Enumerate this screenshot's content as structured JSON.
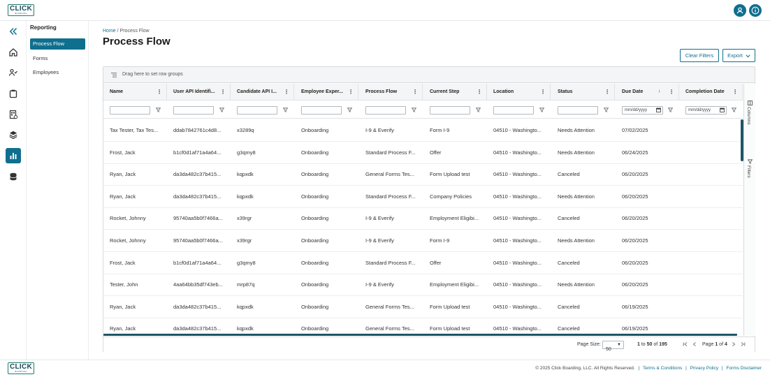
{
  "brand": {
    "logo_text": "CLICK",
    "logo_sub": "BOARDING"
  },
  "colors": {
    "accent": "#0f6f8e",
    "scrollbar": "#1e5565",
    "logo_border": "#1e7d6b"
  },
  "topbar": {
    "icons": [
      "user-circle-icon",
      "info-icon"
    ]
  },
  "rail": {
    "icons": [
      "collapse-icon",
      "home-icon",
      "people-icon",
      "clipboard-icon",
      "document-grid-icon",
      "layers-icon",
      "bar-chart-icon",
      "database-icon"
    ],
    "active": "bar-chart-icon"
  },
  "sidebar": {
    "title": "Reporting",
    "items": [
      {
        "label": "Process Flow",
        "active": true
      },
      {
        "label": "Forms",
        "active": false
      },
      {
        "label": "Employees",
        "active": false
      }
    ]
  },
  "breadcrumb": {
    "home": "Home",
    "separator": "/",
    "current": "Process Flow"
  },
  "page": {
    "title": "Process Flow"
  },
  "toolbar": {
    "clear_filters": "Clear Filters",
    "export": "Export"
  },
  "grid": {
    "group_hint": "Drag here to set row groups",
    "columns": [
      {
        "label": "Name"
      },
      {
        "label": "User API Identifi..."
      },
      {
        "label": "Candidate API I..."
      },
      {
        "label": "Employee Exper..."
      },
      {
        "label": "Process Flow"
      },
      {
        "label": "Current Step"
      },
      {
        "label": "Location"
      },
      {
        "label": "Status"
      },
      {
        "label": "Due Date",
        "sort": "desc"
      },
      {
        "label": "Completion Date"
      }
    ],
    "filters": {
      "date_placeholder": "mm/dd/yyyy"
    },
    "side_tabs": [
      "Columns",
      "Filters"
    ],
    "rows": [
      [
        "Tax Tester, Tax Tes...",
        "ddab7842761c4d8...",
        "x3289q",
        "Onboarding",
        "I-9 & Everify",
        "Form I-9",
        "04510 - Washingto...",
        "Needs Attention",
        "07/02/2025",
        ""
      ],
      [
        "Frost, Jack",
        "b1cf0d1af71a4a64...",
        "g3qmy8",
        "Onboarding",
        "Standard Process F...",
        "Offer",
        "04510 - Washingto...",
        "Needs Attention",
        "06/24/2025",
        ""
      ],
      [
        "Ryan, Jack",
        "da3da482c37b415...",
        "kqpxdk",
        "Onboarding",
        "General Forms Tes...",
        "Form Upload test",
        "04510 - Washingto...",
        "Canceled",
        "06/20/2025",
        ""
      ],
      [
        "Ryan, Jack",
        "da3da482c37b415...",
        "kqpxdk",
        "Onboarding",
        "Standard Process F...",
        "Company Policies",
        "04510 - Washingto...",
        "Needs Attention",
        "06/20/2025",
        ""
      ],
      [
        "Rocket, Johnny",
        "95740aa5b0f7466a...",
        "x39rgr",
        "Onboarding",
        "I-9 & Everify",
        "Employment Eligibi...",
        "04510 - Washingto...",
        "Canceled",
        "06/20/2025",
        ""
      ],
      [
        "Rocket, Johnny",
        "95740aa5b0f7466a...",
        "x39rgr",
        "Onboarding",
        "I-9 & Everify",
        "Form I-9",
        "04510 - Washingto...",
        "Needs Attention",
        "06/20/2025",
        ""
      ],
      [
        "Frost, Jack",
        "b1cf0d1af71a4a64...",
        "g3qmy8",
        "Onboarding",
        "Standard Process F...",
        "Offer",
        "04510 - Washingto...",
        "Canceled",
        "06/20/2025",
        ""
      ],
      [
        "Tester, John",
        "4aa64bb35df743eb...",
        "mrp87q",
        "Onboarding",
        "I-9 & Everify",
        "Employment Eligibi...",
        "04510 - Washingto...",
        "Needs Attention",
        "06/20/2025",
        ""
      ],
      [
        "Ryan, Jack",
        "da3da482c37b415...",
        "kqpxdk",
        "Onboarding",
        "General Forms Tes...",
        "Form Upload test",
        "04510 - Washingto...",
        "Canceled",
        "06/19/2025",
        ""
      ],
      [
        "Ryan, Jack",
        "da3da482c37b415...",
        "kqpxdk",
        "Onboarding",
        "General Forms Tes...",
        "Form Upload test",
        "04510 - Washingto...",
        "Canceled",
        "06/19/2025",
        ""
      ]
    ]
  },
  "pagination": {
    "page_size_label": "Page Size:",
    "page_size": "50",
    "range_from": "1",
    "range_to_word": "to",
    "range_to": "50",
    "of_word": "of",
    "total": "195",
    "page_word": "Page",
    "current_page": "1",
    "total_pages": "4"
  },
  "footer": {
    "copyright": "© 2025 Click Boarding, LLC. All Rights Reserved.",
    "links": [
      "Terms & Conditions",
      "Privacy Policy",
      "Forms Disclaimer"
    ]
  }
}
